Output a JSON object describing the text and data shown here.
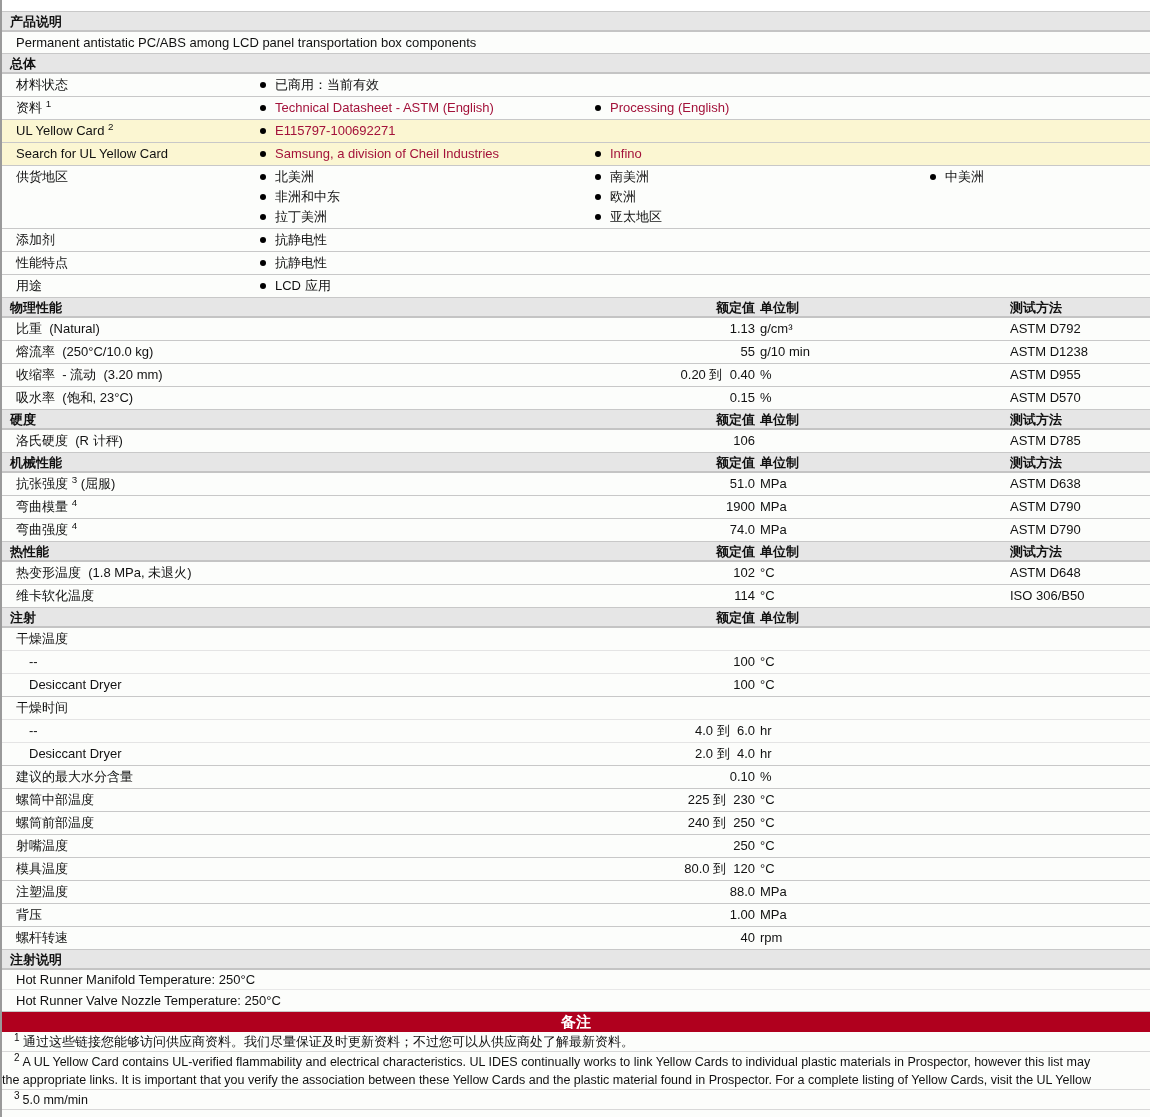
{
  "sections": [
    {
      "kind": "text",
      "title": "产品说明",
      "lines": [
        "Permanent antistatic PC/ABS among LCD panel transportation box components"
      ]
    },
    {
      "kind": "list",
      "title": "总体",
      "rows": [
        {
          "label": "材料状态",
          "highlighted": false,
          "items": [
            {
              "text": "已商用：当前有效",
              "link": false
            }
          ]
        },
        {
          "label": "资料 $^{1}$",
          "highlighted": false,
          "items": [
            {
              "text": "Technical Datasheet - ASTM (English)",
              "link": true
            },
            {
              "text": "Processing (English)",
              "link": true
            }
          ]
        },
        {
          "label": "UL Yellow Card $^{2}$",
          "highlighted": true,
          "items": [
            {
              "text": "E115797-100692271",
              "link": true
            }
          ]
        },
        {
          "label": "Search for UL Yellow Card",
          "highlighted": true,
          "items": [
            {
              "text": "Samsung, a division of Cheil Industries",
              "link": true
            },
            {
              "text": "Infino",
              "link": true
            }
          ]
        },
        {
          "label": "供货地区",
          "highlighted": false,
          "columns": [
            [
              {
                "text": "北美洲",
                "link": false
              },
              {
                "text": "非洲和中东",
                "link": false
              },
              {
                "text": "拉丁美洲",
                "link": false
              }
            ],
            [
              {
                "text": "南美洲",
                "link": false
              },
              {
                "text": "欧洲",
                "link": false
              },
              {
                "text": "亚太地区",
                "link": false
              }
            ],
            [
              {
                "text": "中美洲",
                "link": false
              }
            ]
          ]
        },
        {
          "label": "添加剂",
          "highlighted": false,
          "items": [
            {
              "text": "抗静电性",
              "link": false
            }
          ]
        },
        {
          "label": "性能特点",
          "highlighted": false,
          "items": [
            {
              "text": "抗静电性",
              "link": false
            }
          ]
        },
        {
          "label": "用途",
          "highlighted": false,
          "items": [
            {
              "text": "LCD 应用",
              "link": false
            }
          ]
        }
      ]
    },
    {
      "kind": "props",
      "title": "物理性能",
      "headers": [
        "额定值",
        "单位制",
        "测试方法"
      ],
      "rows": [
        {
          "label": "比重  (Natural)",
          "value": "1.13",
          "unit": "g/cm³",
          "method": "ASTM D792"
        },
        {
          "label": "熔流率  (250°C/10.0 kg)",
          "value": "55",
          "unit": "g/10 min",
          "method": "ASTM D1238"
        },
        {
          "label": "收缩率  - 流动  (3.20 mm)",
          "value": "0.20 到  0.40",
          "unit": "%",
          "method": "ASTM D955"
        },
        {
          "label": "吸水率  (饱和, 23°C)",
          "value": "0.15",
          "unit": "%",
          "method": "ASTM D570"
        }
      ]
    },
    {
      "kind": "props",
      "title": "硬度",
      "headers": [
        "额定值",
        "单位制",
        "测试方法"
      ],
      "rows": [
        {
          "label": "洛氏硬度  (R 计秤)",
          "value": "106",
          "method": "ASTM D785"
        }
      ]
    },
    {
      "kind": "props",
      "title": "机械性能",
      "headers": [
        "额定值",
        "单位制",
        "测试方法"
      ],
      "rows": [
        {
          "label": "抗张强度 $^{3}$ (屈服)",
          "value": "51.0",
          "unit": "MPa",
          "method": "ASTM D638"
        },
        {
          "label": "弯曲模量 $^{4}$",
          "value": "1900",
          "unit": "MPa",
          "method": "ASTM D790"
        },
        {
          "label": "弯曲强度 $^{4}$",
          "value": "74.0",
          "unit": "MPa",
          "method": "ASTM D790"
        }
      ]
    },
    {
      "kind": "props",
      "title": "热性能",
      "headers": [
        "额定值",
        "单位制",
        "测试方法"
      ],
      "rows": [
        {
          "label": "热变形温度  (1.8 MPa, 未退火)",
          "value": "102",
          "unit": "°C",
          "method": "ASTM D648"
        },
        {
          "label": "维卡软化温度",
          "value": "114",
          "unit": "°C",
          "method": "ISO 306/B50"
        }
      ]
    },
    {
      "kind": "props",
      "title": "注射",
      "headers": [
        "额定值",
        "单位制"
      ],
      "rows": [
        {
          "label": "干燥温度",
          "children": [
            {
              "label": "--",
              "value": "100",
              "unit": "°C"
            },
            {
              "label": "Desiccant Dryer",
              "value": "100",
              "unit": "°C"
            }
          ]
        },
        {
          "label": "干燥时间",
          "children": [
            {
              "label": "--",
              "value": "4.0 到  6.0",
              "unit": "hr"
            },
            {
              "label": "Desiccant Dryer",
              "value": "2.0 到  4.0",
              "unit": "hr"
            }
          ]
        },
        {
          "label": "建议的最大水分含量",
          "value": "0.10",
          "unit": "%"
        },
        {
          "label": "螺筒中部温度",
          "value": "225 到  230",
          "unit": "°C"
        },
        {
          "label": "螺筒前部温度",
          "value": "240 到  250",
          "unit": "°C"
        },
        {
          "label": "射嘴温度",
          "value": "250",
          "unit": "°C"
        },
        {
          "label": "模具温度",
          "value": "80.0 到  120",
          "unit": "°C"
        },
        {
          "label": "注塑温度",
          "value": "88.0",
          "unit": "MPa"
        },
        {
          "label": "背压",
          "value": "1.00",
          "unit": "MPa"
        },
        {
          "label": "螺杆转速",
          "value": "40",
          "unit": "rpm"
        }
      ]
    },
    {
      "kind": "text",
      "title": "注射说明",
      "lines": [
        "Hot Runner Manifold Temperature: 250°C",
        "Hot Runner Valve Nozzle Temperature: 250°C"
      ]
    }
  ],
  "notes": {
    "title": "备注",
    "items": [
      {
        "mark": "1",
        "lines": [
          "通过这些链接您能够访问供应商资料。我们尽量保证及时更新资料；不过您可以从供应商处了解最新资料。"
        ]
      },
      {
        "mark": "2",
        "lines": [
          "A UL Yellow Card contains UL-verified flammability and electrical characteristics. UL IDES continually works to link Yellow Cards to individual plastic materials in Prospector, however this list may",
          "the appropriate links. It is important that you verify the association between these Yellow Cards and the plastic material found in Prospector. For a complete listing of Yellow Cards, visit the UL Yellow"
        ]
      },
      {
        "mark": "3",
        "lines": [
          "5.0 mm/min"
        ]
      }
    ]
  }
}
